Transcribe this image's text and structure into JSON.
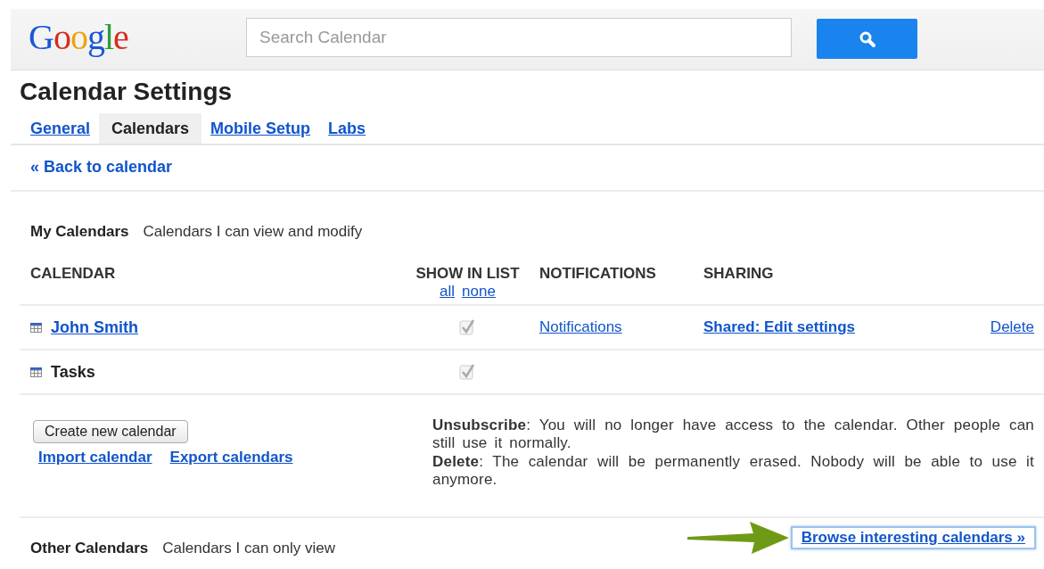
{
  "header": {
    "logo": "Google",
    "search": {
      "placeholder": "Search Calendar"
    }
  },
  "title": "Calendar Settings",
  "tabs": [
    {
      "label": "General",
      "selected": false
    },
    {
      "label": "Calendars",
      "selected": true
    },
    {
      "label": "Mobile Setup",
      "selected": false
    },
    {
      "label": "Labs",
      "selected": false
    }
  ],
  "back_link": "« Back to calendar",
  "my_calendars": {
    "heading": "My Calendars",
    "subtitle": "Calendars I can view and modify",
    "columns": [
      "CALENDAR",
      "SHOW IN LIST",
      "NOTIFICATIONS",
      "SHARING"
    ],
    "show_all": "all",
    "show_none": "none",
    "rows": [
      {
        "name": "John Smith",
        "link": true,
        "checked": true,
        "notifications": "Notifications",
        "sharing": "Shared: Edit settings",
        "delete": "Delete"
      },
      {
        "name": "Tasks",
        "link": false,
        "checked": true
      }
    ],
    "create_button": "Create new calendar",
    "import_link": "Import calendar",
    "export_link": "Export calendars",
    "notes": [
      "**Unsubscribe**: You will no longer have access to the calendar. Other people can still use it normally.",
      "**Delete**: The calendar will be permanently erased. Nobody will be able to use it anymore."
    ]
  },
  "other_calendars": {
    "heading": "Other Calendars",
    "subtitle": "Calendars I can only view",
    "browse_link": "Browse interesting calendars »"
  }
}
